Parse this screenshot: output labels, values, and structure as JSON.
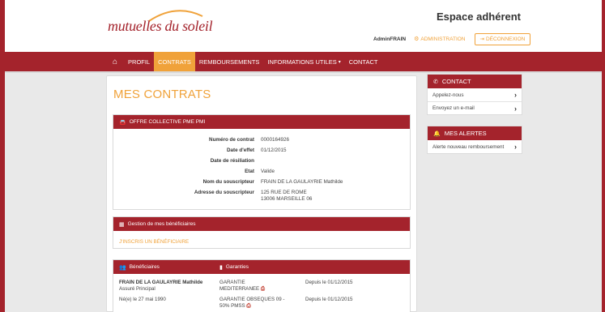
{
  "header": {
    "logo": "mutuelles du soleil",
    "espace": "Espace adhérent",
    "username": "AdminFRAIN",
    "admin_label": "ADMINISTRATION",
    "logout_label": "DÉCONNEXION"
  },
  "nav": {
    "items": [
      "PROFIL",
      "CONTRATS",
      "REMBOURSEMENTS",
      "INFORMATIONS UTILES",
      "CONTACT"
    ],
    "active": "CONTRATS"
  },
  "page": {
    "title": "MES CONTRATS"
  },
  "offre": {
    "heading": "OFFRE COLLECTIVE PME PMI",
    "fields": [
      {
        "label": "Numéro de contrat",
        "value": "0000164926"
      },
      {
        "label": "Date d'effet",
        "value": "01/12/2015"
      },
      {
        "label": "Date de résiliation",
        "value": ""
      },
      {
        "label": "Etat",
        "value": "Valide"
      },
      {
        "label": "Nom du souscripteur",
        "value": "FRAIN DE LA GAULAYRIE Mathilde"
      },
      {
        "label": "Adresse du souscripteur",
        "value": "125 RUE DE ROME",
        "value2": "13006 MARSEILLE 06"
      }
    ]
  },
  "gestion": {
    "heading": "Gestion de mes bénéficiaires",
    "link": "J'INSCRIS UN BÉNÉFICIAIRE"
  },
  "beneficiaires": {
    "heading_benef": "Bénéficiaires",
    "heading_garanties": "Garanties",
    "name": "FRAIN DE LA GAULAYRIE Mathilde",
    "role": "Assuré Principal",
    "birth": "Né(e) le 27 mai 1990",
    "garanties": [
      {
        "line1": "GARANTIE",
        "line2": "MEDITERRANEE",
        "since": "Depuis le 01/12/2015"
      },
      {
        "line1": "GARANTIE OBSEQUES 09 -",
        "line2": "50% PMSS",
        "since": "Depuis le 01/12/2015"
      }
    ]
  },
  "contact": {
    "heading": "CONTACT",
    "items": [
      "Appelez-nous",
      "Envoyez un e-mail"
    ]
  },
  "alertes": {
    "heading": "MES ALERTES",
    "items": [
      "Alerte nouveau remboursement"
    ]
  },
  "colors": {
    "brand": "#a4232c",
    "accent": "#f0a23a"
  }
}
